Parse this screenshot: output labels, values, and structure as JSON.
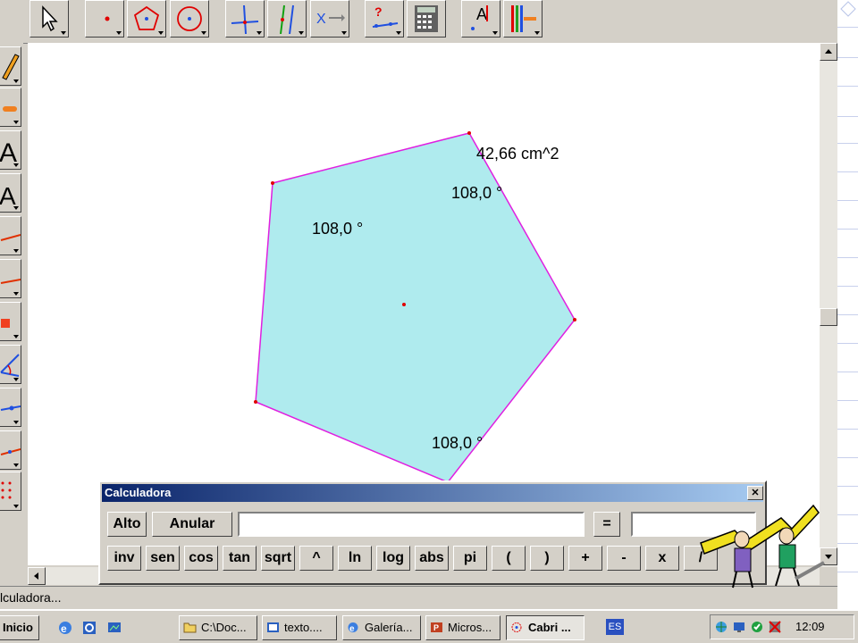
{
  "canvas": {
    "area_label": "42,66 cm^2",
    "angle_labels": [
      "108,0 °",
      "108,0 °",
      "108,0 °"
    ],
    "polygon_fill": "#afebee",
    "polygon_stroke": "#e020e0",
    "point_color": "#e00000"
  },
  "toolbar": {
    "tools": [
      {
        "name": "pointer-tool-icon"
      },
      {
        "name": "point-tool-icon"
      },
      {
        "name": "polygon-tool-icon"
      },
      {
        "name": "circle-tool-icon"
      },
      {
        "name": "perpendicular-line-tool-icon"
      },
      {
        "name": "parallel-line-tool-icon"
      },
      {
        "name": "transform-tool-icon"
      },
      {
        "name": "macro-tool-icon"
      },
      {
        "name": "calculator-tool-icon"
      },
      {
        "name": "text-label-tool-icon"
      },
      {
        "name": "display-tool-icon"
      }
    ]
  },
  "calculator": {
    "title": "Calculadora",
    "close_label": "✕",
    "alto_label": "Alto",
    "anular_label": "Anular",
    "equals_label": "=",
    "input_value": "",
    "result_value": "",
    "functions": [
      "inv",
      "sen",
      "cos",
      "tan",
      "sqrt",
      "^",
      "ln",
      "log",
      "abs",
      "pi",
      "(",
      ")",
      "+",
      "-",
      "x",
      "/"
    ]
  },
  "status": {
    "text": "lculadora..."
  },
  "taskbar": {
    "start_label": "Inicio",
    "tasks": [
      {
        "label": "C:\\Doc..."
      },
      {
        "label": "texto...."
      },
      {
        "label": "Galería..."
      },
      {
        "label": "Micros..."
      },
      {
        "label": "Cabri ..."
      }
    ],
    "language": "ES",
    "clock": "12:09"
  }
}
